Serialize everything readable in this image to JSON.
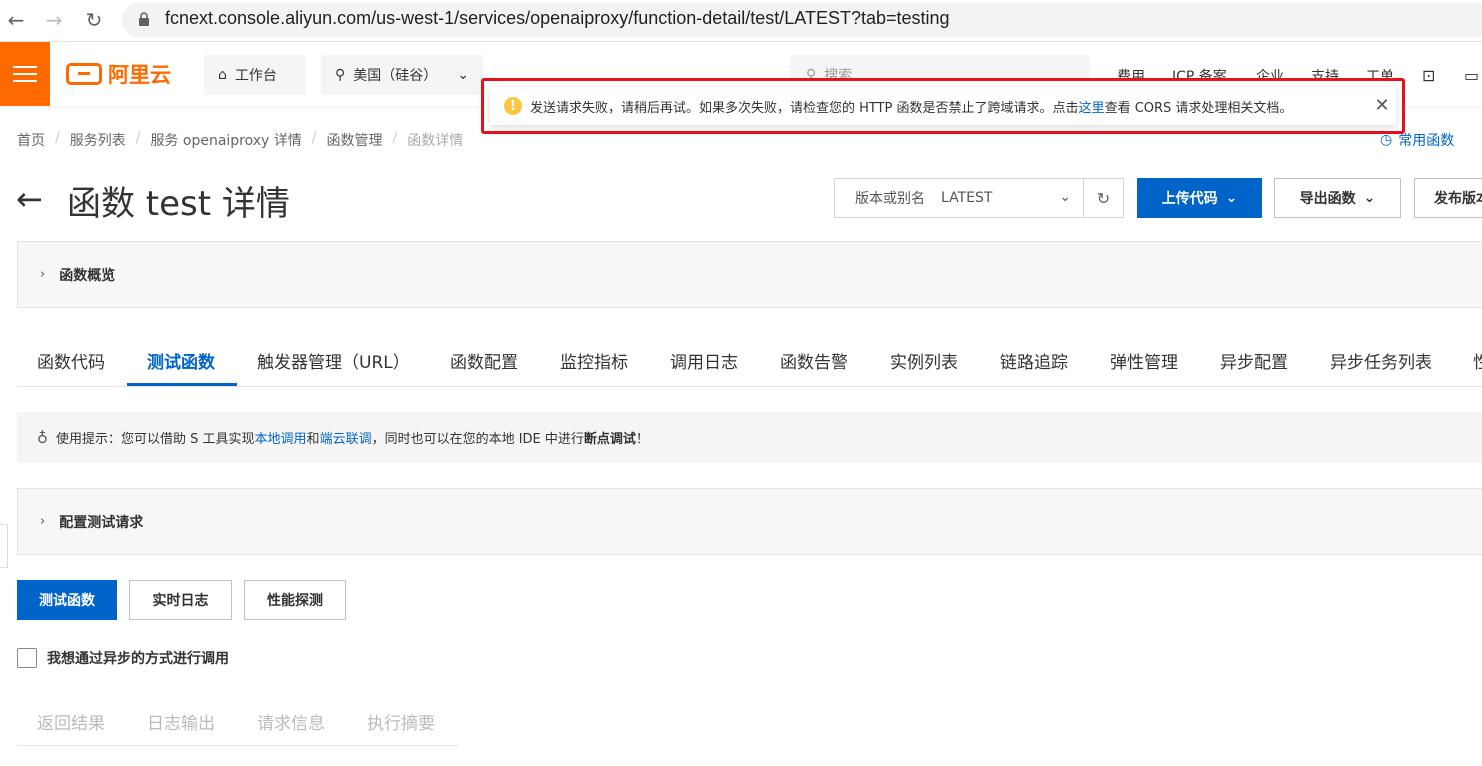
{
  "browser": {
    "url": "fcnext.console.aliyun.com/us-west-1/services/openaiproxy/function-detail/test/LATEST?tab=testing"
  },
  "topnav": {
    "logo_text": "阿里云",
    "workbench": "工作台",
    "region": "美国（硅谷）",
    "search_placeholder": "搜索...",
    "links": [
      "费用",
      "ICP 备案",
      "企业",
      "支持",
      "工单"
    ]
  },
  "alert": {
    "text_before": "发送请求失败，请稍后再试。如果多次失败，请检查您的 HTTP 函数是否禁止了跨域请求。点击",
    "link": "这里",
    "text_after": "查看 CORS 请求处理相关文档。"
  },
  "breadcrumb": {
    "items": [
      "首页",
      "服务列表",
      "服务 openaiproxy 详情",
      "函数管理",
      "函数详情"
    ],
    "common_functions": "常用函数"
  },
  "header": {
    "title": "函数 test 详情",
    "version_label": "版本或别名",
    "version_value": "LATEST",
    "upload_code": "上传代码",
    "export_function": "导出函数",
    "publish_version": "发布版本"
  },
  "overview_panel": {
    "label": "函数概览"
  },
  "tabs": [
    "函数代码",
    "测试函数",
    "触发器管理（URL）",
    "函数配置",
    "监控指标",
    "调用日志",
    "函数告警",
    "实例列表",
    "链路追踪",
    "弹性管理",
    "异步配置",
    "异步任务列表",
    "性"
  ],
  "tip": {
    "prefix": "使用提示：您可以借助 S 工具实现",
    "link1": "本地调用",
    "and": "和",
    "link2": "端云联调",
    "middle": "，同时也可以在您的本地 IDE 中进行",
    "bold": "断点调试",
    "suffix": "！"
  },
  "config_panel": {
    "label": "配置测试请求"
  },
  "actions": {
    "test_function": "测试函数",
    "realtime_log": "实时日志",
    "performance_probe": "性能探测"
  },
  "async_checkbox": {
    "label": "我想通过异步的方式进行调用",
    "checked": false
  },
  "result_tabs": [
    "返回结果",
    "日志输出",
    "请求信息",
    "执行摘要"
  ]
}
